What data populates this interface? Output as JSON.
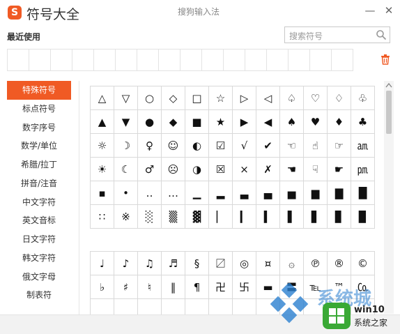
{
  "window": {
    "logo": "S",
    "title": "符号大全",
    "subtitle": "搜狗输入法",
    "minimize": "—",
    "close": "✕"
  },
  "recent": {
    "label": "最近使用",
    "cells": 16
  },
  "search": {
    "placeholder": "搜索符号"
  },
  "categories": [
    "特殊符号",
    "标点符号",
    "数字序号",
    "数学/单位",
    "希腊/拉丁",
    "拼音/注音",
    "中文字符",
    "英文音标",
    "日文字符",
    "韩文字符",
    "俄文字母",
    "制表符"
  ],
  "active_category": 0,
  "grid1": [
    [
      "△",
      "▽",
      "○",
      "◇",
      "□",
      "☆",
      "▷",
      "◁",
      "♤",
      "♡",
      "♢",
      "♧"
    ],
    [
      "▲",
      "▼",
      "●",
      "◆",
      "■",
      "★",
      "▶",
      "◀",
      "♠",
      "♥",
      "♦",
      "♣"
    ],
    [
      "☼",
      "☽",
      "♀",
      "☺",
      "◐",
      "☑",
      "√",
      "✔",
      "☜",
      "☝",
      "☞",
      "㏂"
    ],
    [
      "☀",
      "☾",
      "♂",
      "☹",
      "◑",
      "☒",
      "×",
      "✗",
      "☚",
      "☟",
      "☛",
      "㏘"
    ],
    [
      "▪",
      "•",
      "‥",
      "…",
      "▁",
      "▂",
      "▃",
      "▄",
      "▅",
      "▆",
      "▇",
      "█"
    ],
    [
      "∷",
      "※",
      "░",
      "▒",
      "▓",
      "▏",
      "▎",
      "▍",
      "▌",
      "▋",
      "▊",
      "▉"
    ]
  ],
  "grid2": [
    [
      "♩",
      "♪",
      "♫",
      "♬",
      "§",
      "〼",
      "◎",
      "¤",
      "۞",
      "℗",
      "®",
      "©"
    ],
    [
      "♭",
      "♯",
      "♮",
      "‖",
      "¶",
      "卍",
      "卐",
      "▬",
      "〓",
      "℡",
      "™",
      "㏇"
    ],
    [
      "",
      "",
      "",
      "",
      "",
      "",
      "",
      "",
      "",
      "",
      "",
      ""
    ]
  ],
  "watermark": {
    "big_text": "系统城",
    "brand": "win10",
    "site": "系统之家"
  },
  "colors": {
    "accent": "#f05a24",
    "watermark_blue": "#2a7fd0",
    "watermark_green": "#3aa935"
  }
}
